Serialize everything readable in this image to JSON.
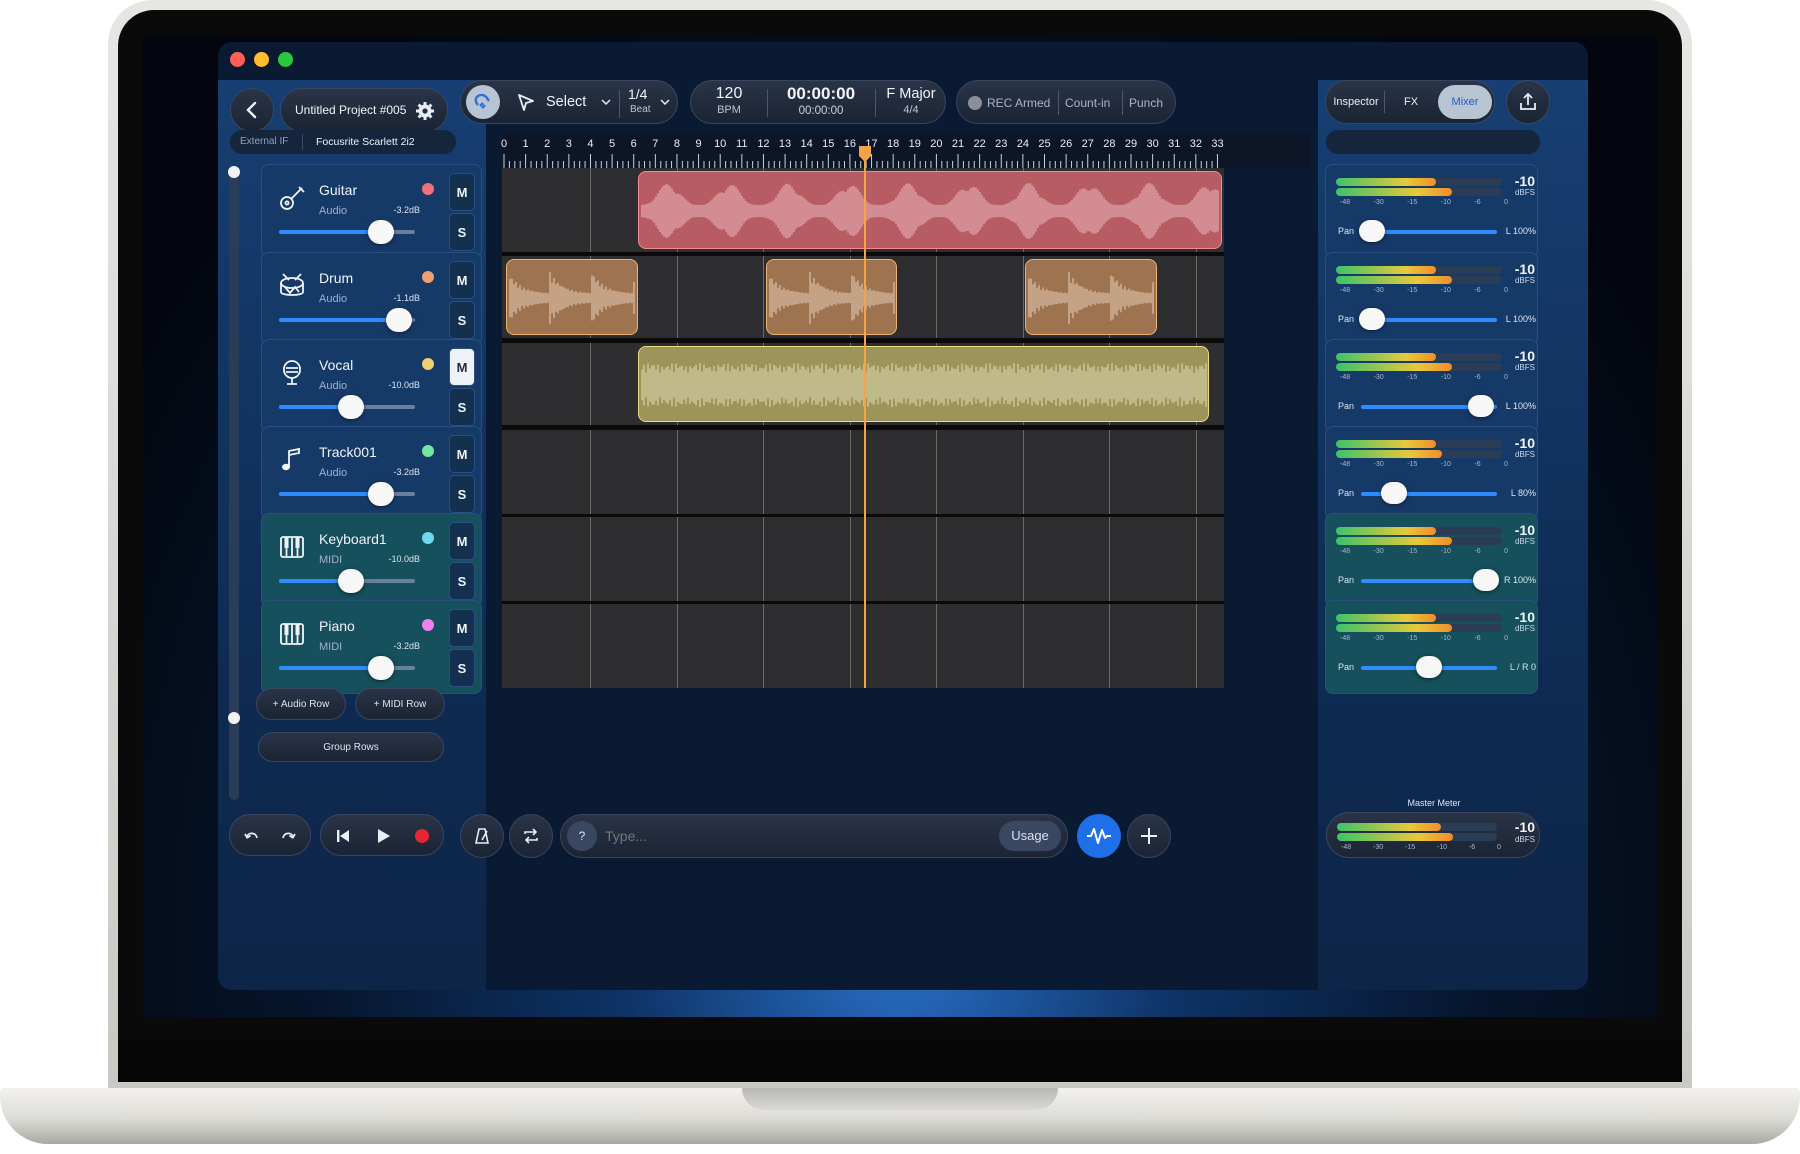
{
  "project": {
    "name": "Untitled Project #005"
  },
  "audio_interface": {
    "label": "External IF",
    "device": "Focusrite Scarlett 2i2"
  },
  "toolbar": {
    "tool": "Select",
    "grid_value": "1/4",
    "grid_unit": "Beat",
    "tempo_value": "120",
    "tempo_unit": "BPM",
    "timecode": "00:00:00",
    "timecode_sub": "00:00:00",
    "key": "F Major",
    "time_signature": "4/4",
    "rec_armed": "REC Armed",
    "count_in": "Count-in",
    "punch": "Punch"
  },
  "panel_tabs": [
    "Inspector",
    "FX",
    "Mixer"
  ],
  "active_tab": "Mixer",
  "ruler": [
    "0",
    "1",
    "2",
    "3",
    "4",
    "5",
    "6",
    "7",
    "8",
    "9",
    "10",
    "11",
    "12",
    "13",
    "14",
    "15",
    "16",
    "17",
    "18",
    "19",
    "20",
    "21",
    "22",
    "23",
    "24",
    "25",
    "26",
    "27",
    "28",
    "29",
    "30",
    "31",
    "32",
    "33"
  ],
  "tracks": [
    {
      "name": "Guitar",
      "type": "Audio",
      "db": "-3.2dB",
      "color": "#f2707a",
      "icon": "guitar-icon",
      "volume": 0.75,
      "mute_label": "M",
      "solo_label": "S",
      "muted": false,
      "meter": {
        "value": "-10",
        "unit": "dBFS",
        "pan_label": "Pan",
        "pan_value": "L 100%",
        "pan": 0.08
      }
    },
    {
      "name": "Drum",
      "type": "Audio",
      "db": "-1.1dB",
      "color": "#f0a070",
      "icon": "drum-icon",
      "volume": 0.88,
      "mute_label": "M",
      "solo_label": "S",
      "muted": false,
      "meter": {
        "value": "-10",
        "unit": "dBFS",
        "pan_label": "Pan",
        "pan_value": "L 100%",
        "pan": 0.08
      }
    },
    {
      "name": "Vocal",
      "type": "Audio",
      "db": "-10.0dB",
      "color": "#f0d070",
      "icon": "microphone-icon",
      "volume": 0.53,
      "mute_label": "M",
      "solo_label": "S",
      "muted": true,
      "meter": {
        "value": "-10",
        "unit": "dBFS",
        "pan_label": "Pan",
        "pan_value": "L 100%",
        "pan": 0.88
      }
    },
    {
      "name": "Track001",
      "type": "Audio",
      "db": "-3.2dB",
      "color": "#70e8a0",
      "icon": "music-note-icon",
      "volume": 0.75,
      "mute_label": "M",
      "solo_label": "S",
      "muted": false,
      "meter": {
        "value": "-10",
        "unit": "dBFS",
        "pan_label": "Pan",
        "pan_value": "L 80%",
        "pan": 0.24
      }
    },
    {
      "name": "Keyboard1",
      "type": "MIDI",
      "db": "-10.0dB",
      "color": "#70d8f0",
      "icon": "piano-icon",
      "volume": 0.53,
      "mute_label": "M",
      "solo_label": "S",
      "muted": false,
      "meter": {
        "value": "-10",
        "unit": "dBFS",
        "pan_label": "Pan",
        "pan_value": "R 100%",
        "pan": 0.92
      }
    },
    {
      "name": "Piano",
      "type": "MIDI",
      "db": "-3.2dB",
      "color": "#f080f0",
      "icon": "piano-icon",
      "volume": 0.75,
      "mute_label": "M",
      "solo_label": "S",
      "muted": false,
      "meter": {
        "value": "-10",
        "unit": "dBFS",
        "pan_label": "Pan",
        "pan_value": "L / R 0",
        "pan": 0.5
      }
    }
  ],
  "meter_scale": [
    "-48",
    "-30",
    "-15",
    "-10",
    "-6",
    "0"
  ],
  "buttons": {
    "add_audio_row": "+ Audio Row",
    "add_midi_row": "+ MIDI Row",
    "group_rows": "Group Rows",
    "usage": "Usage",
    "help": "?"
  },
  "prompt": {
    "placeholder": "Type..."
  },
  "master": {
    "label": "Master Meter",
    "value": "-10",
    "unit": "dBFS"
  },
  "clips": [
    {
      "track": 0,
      "start_bar": 6.2,
      "end_bar": 33.4,
      "fill": "#b75c63",
      "border": "#f58a93",
      "wave": "#f2c8cc"
    },
    {
      "track": 1,
      "start_bar": 0.1,
      "end_bar": 6.2,
      "fill": "#9e7450",
      "border": "#f0b070",
      "wave": "#f0dcc8"
    },
    {
      "track": 1,
      "start_bar": 12.1,
      "end_bar": 18.2,
      "fill": "#9e7450",
      "border": "#f0b070",
      "wave": "#f0dcc8"
    },
    {
      "track": 1,
      "start_bar": 24.1,
      "end_bar": 30.2,
      "fill": "#9e7450",
      "border": "#f0b070",
      "wave": "#f0dcc8"
    },
    {
      "track": 2,
      "start_bar": 6.2,
      "end_bar": 32.6,
      "fill": "#9c9458",
      "border": "#e8e080",
      "wave": "#ece6c8"
    }
  ],
  "playhead_bar": 16.7
}
